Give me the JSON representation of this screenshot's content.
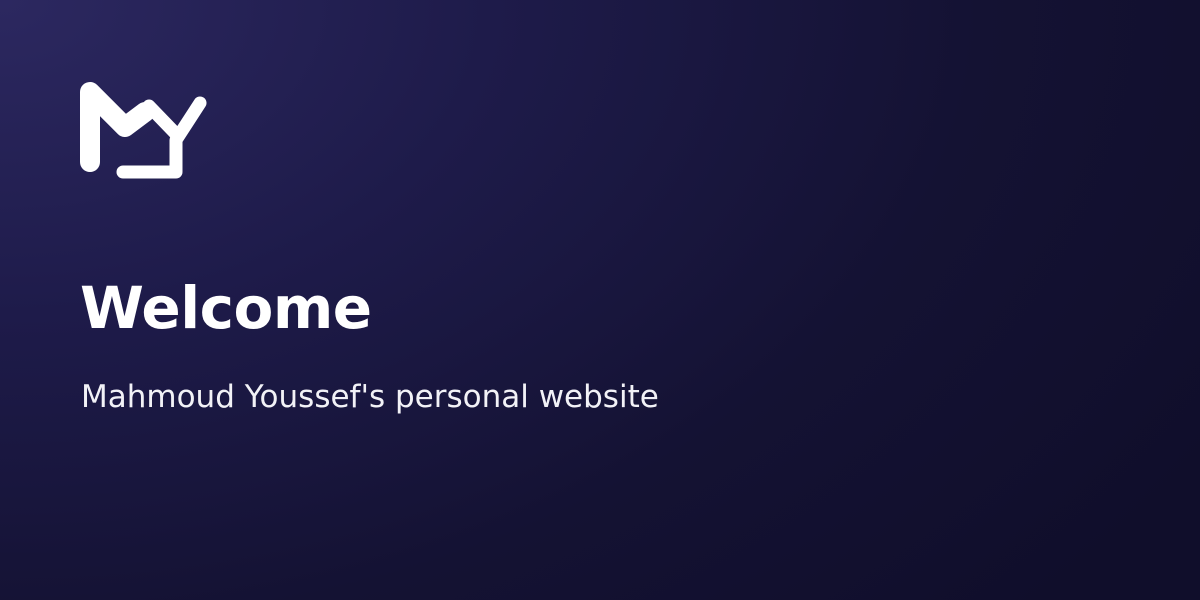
{
  "logo": {
    "icon": "my-monogram-logo",
    "color": "#ffffff"
  },
  "heading": {
    "title": "Welcome",
    "subtitle": "Mahmoud Youssef's personal website"
  },
  "colors": {
    "background_light": "#2c2860",
    "background_dark": "#100e2b",
    "text": "#ffffff"
  }
}
